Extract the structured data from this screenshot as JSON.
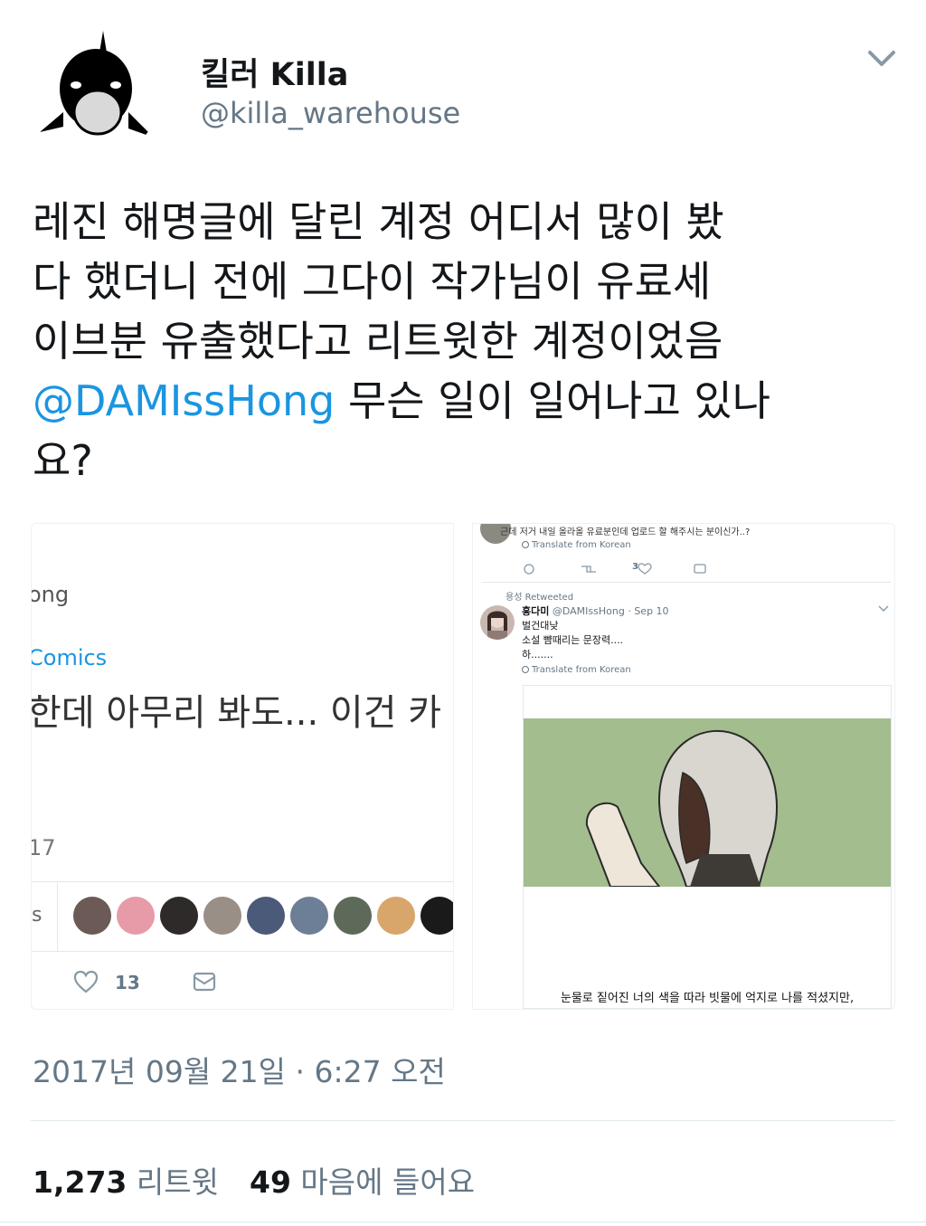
{
  "author": {
    "display_name": "킬러 Killa",
    "handle": "@killa_warehouse"
  },
  "tweet": {
    "text_line1": "레진 해명글에 달린 계정 어디서 많이 봤",
    "text_line2": "다 했더니 전에 그다이 작가님이 유료세",
    "text_line3": "이브분 유출했다고 리트윗한 계정이었음",
    "mention": "@DAMIssHong",
    "text_line4_rest": " 무슨 일이 일어나고 있나",
    "text_line5": "요?"
  },
  "media_left": {
    "name_fragment": "ong",
    "link_fragment": "Comics",
    "text_fragment": "한데 아무리 봐도... 이건 카",
    "date_fragment": "17",
    "s_fragment": "s",
    "likes": "13",
    "avatar_colors": [
      "#6b5a55",
      "#e79aa8",
      "#2e2a2a",
      "#9a8f86",
      "#4b5a78",
      "#6d7f96",
      "#5d6a5a",
      "#d8a66a",
      "#1a1a1a"
    ]
  },
  "media_right": {
    "top_line": "근데 저거 내일 올라올 유료분인데 업로드 할 해주시는 분이신가..?",
    "translate": "Translate from Korean",
    "like_count": "3",
    "retweet_line": "용성 Retweeted",
    "name": "홍다미",
    "handle_date": "@DAMIssHong · Sep 10",
    "line1": "벌건대낮",
    "line2": "소설 뺨때리는 문장력....",
    "line3": "하.......",
    "caption": "눈물로 짙어진 너의 색을 따라 빗물에 억지로 나를 적셨지만,",
    "scene_color": "#a3bd8e"
  },
  "timestamp": "2017년 09월 21일 · 6:27 오전",
  "stats": {
    "retweets_count": "1,273",
    "retweets_label": "리트윗",
    "likes_count": "49",
    "likes_label": "마음에 들어요"
  },
  "icons": [
    "orca-avatar",
    "chevron-down-icon",
    "heart-icon",
    "dm-icon",
    "reply-icon",
    "retweet-icon"
  ],
  "colors": {
    "link": "#1b95e0",
    "muted": "#657786",
    "text": "#14171a"
  }
}
